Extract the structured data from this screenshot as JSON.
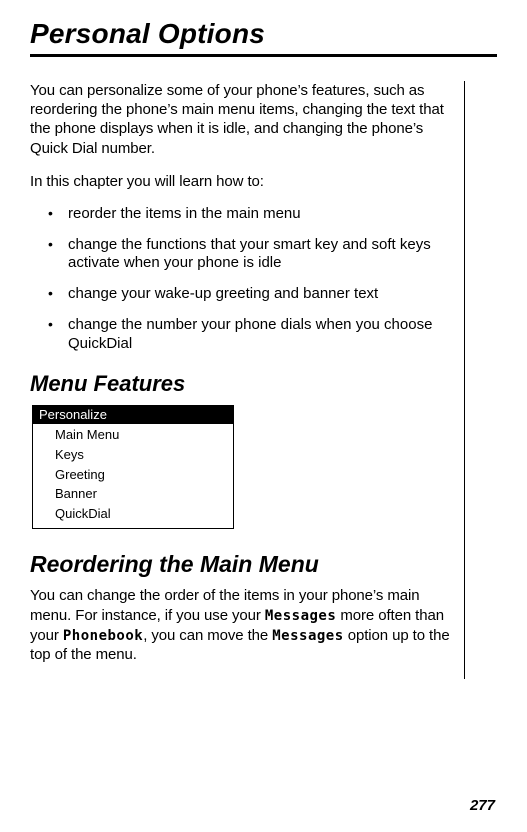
{
  "title": "Personal Options",
  "intro_paragraph": "You can personalize some of your phone’s features, such as reordering the phone’s main menu items, changing the text that the phone displays when it is idle, and changing the phone’s Quick Dial number.",
  "learn_intro": "In this chapter you will learn how to:",
  "learn_items": [
    "reorder the items in the main menu",
    "change the functions that your smart key and soft keys activate when your phone is idle",
    "change your wake-up greeting and banner text",
    "change the number your phone dials when you choose QuickDial"
  ],
  "menu_features_heading": "Menu Features",
  "menu_box": {
    "header": "Personalize",
    "items": [
      "Main Menu",
      "Keys",
      "Greeting",
      "Banner",
      "QuickDial"
    ]
  },
  "reorder_heading": "Reordering the Main Menu",
  "reorder_paragraph_pre": "You can change the order of the items in your phone’s main menu. For instance, if you use your ",
  "reorder_monoword1": "Messages",
  "reorder_paragraph_mid1": " more often than your ",
  "reorder_monoword2": "Phonebook",
  "reorder_paragraph_mid2": ", you can move the ",
  "reorder_monoword3": "Messages",
  "reorder_paragraph_post": " option up to the top of the menu.",
  "page_number": "277"
}
